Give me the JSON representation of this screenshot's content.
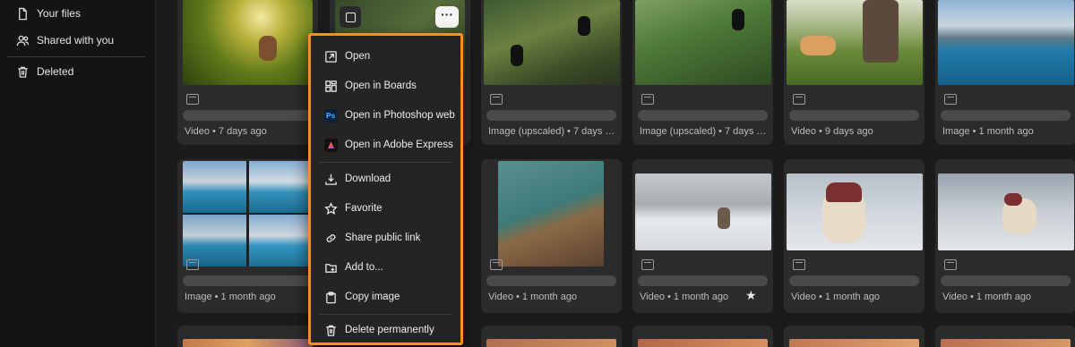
{
  "sidebar": {
    "items": [
      {
        "label": "Your files",
        "icon": "file-icon"
      },
      {
        "label": "Shared with you",
        "icon": "people-icon"
      },
      {
        "label": "Deleted",
        "icon": "trash-icon"
      }
    ]
  },
  "grid": {
    "row1": [
      {
        "meta": "Video • 7 days ago"
      },
      {
        "meta": ""
      },
      {
        "meta": "Image (upscaled) • 7 days a..."
      },
      {
        "meta": "Image (upscaled) • 7 days a..."
      },
      {
        "meta": "Video • 9 days ago"
      },
      {
        "meta": "Image • 1 month ago"
      }
    ],
    "row2": [
      {
        "meta": "Image • 1 month ago"
      },
      {
        "meta": ""
      },
      {
        "meta": "Video • 1 month ago"
      },
      {
        "meta": "Video • 1 month ago"
      },
      {
        "meta": "Video • 1 month ago"
      },
      {
        "meta": "Video • 1 month ago"
      }
    ]
  },
  "context_menu": {
    "items": [
      {
        "label": "Open",
        "icon": "open-arrow-icon"
      },
      {
        "label": "Open in Boards",
        "icon": "boards-icon"
      },
      {
        "label": "Open in Photoshop web",
        "icon": "photoshop-icon"
      },
      {
        "label": "Open in Adobe Express",
        "icon": "adobe-express-icon"
      },
      {
        "label": "Download",
        "icon": "download-icon"
      },
      {
        "label": "Favorite",
        "icon": "star-icon"
      },
      {
        "label": "Share public link",
        "icon": "link-icon"
      },
      {
        "label": "Add to...",
        "icon": "folder-add-icon"
      },
      {
        "label": "Copy image",
        "icon": "clipboard-icon"
      },
      {
        "label": "Delete permanently",
        "icon": "trash-icon"
      }
    ],
    "ps_badge": "Ps",
    "more_label": "···"
  },
  "colors": {
    "accent_border": "#f3931f",
    "background": "#1b1b1b",
    "card": "#2b2b2b"
  }
}
